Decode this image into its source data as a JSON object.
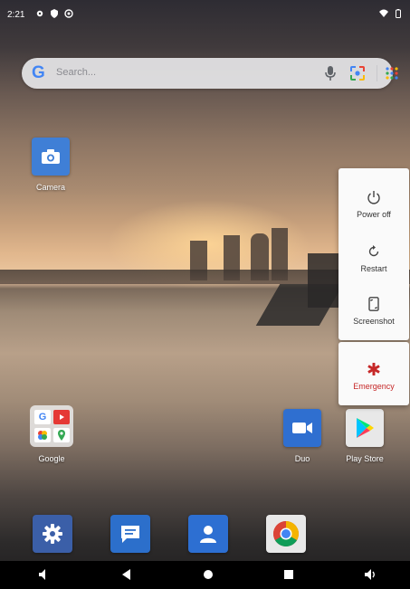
{
  "status_bar": {
    "time": "2:21",
    "icons": [
      "gear-icon",
      "shield-icon",
      "vpn-icon"
    ],
    "right_icons": [
      "wifi-icon",
      "battery-icon"
    ]
  },
  "search": {
    "placeholder": "Search..."
  },
  "desktop_apps": [
    {
      "label": "Camera"
    },
    {
      "label": "Google"
    },
    {
      "label": "Duo"
    },
    {
      "label": "Play Store"
    }
  ],
  "dock": [
    "settings-app",
    "messages-app",
    "contacts-app",
    "chrome-app"
  ],
  "power_menu": {
    "items": [
      {
        "label": "Power off"
      },
      {
        "label": "Restart"
      },
      {
        "label": "Screenshot"
      }
    ],
    "emergency": {
      "label": "Emergency"
    }
  },
  "colors": {
    "emergency": "#c62828",
    "camera_tile": "#3f7fd6",
    "duo_tile": "#2f6fd0",
    "dock_settings": "#3b5fa8",
    "dock_messages": "#2c6fcb",
    "dock_contacts": "#2d6fd2"
  }
}
